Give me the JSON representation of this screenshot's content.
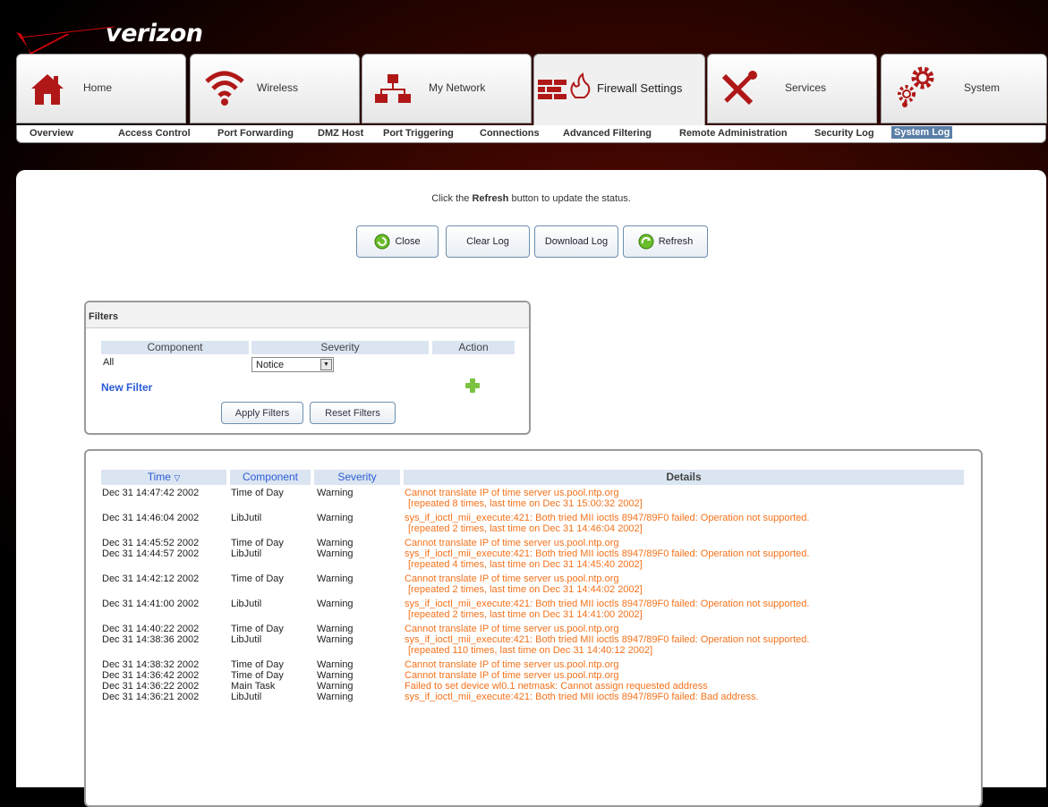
{
  "brand": {
    "logo_text": "verizon"
  },
  "tabs": [
    {
      "label": "Home",
      "icon": "home-icon"
    },
    {
      "label": "Wireless",
      "icon": "wifi-icon"
    },
    {
      "label": "My Network",
      "icon": "network-icon"
    },
    {
      "label": "Firewall Settings",
      "icon": "firewall-icon",
      "active": true
    },
    {
      "label": "Services",
      "icon": "tools-icon"
    },
    {
      "label": "System",
      "icon": "gears-icon"
    }
  ],
  "subnav": [
    {
      "label": "Overview"
    },
    {
      "label": "Access Control"
    },
    {
      "label": "Port Forwarding"
    },
    {
      "label": "DMZ Host"
    },
    {
      "label": "Port Triggering"
    },
    {
      "label": "Connections"
    },
    {
      "label": "Advanced Filtering"
    },
    {
      "label": "Remote Administration"
    },
    {
      "label": "Security Log"
    },
    {
      "label": "System Log",
      "active": true
    }
  ],
  "notice": {
    "before": "Click the ",
    "strong": "Refresh",
    "after": " button to update the status."
  },
  "buttons": {
    "close": "Close",
    "clear": "Clear Log",
    "download": "Download Log",
    "refresh": "Refresh"
  },
  "filters": {
    "title": "Filters",
    "headers": {
      "component": "Component",
      "severity": "Severity",
      "action": "Action"
    },
    "row": {
      "component": "All",
      "severity": "Notice"
    },
    "new_filter": "New Filter",
    "apply": "Apply Filters",
    "reset": "Reset Filters"
  },
  "log": {
    "headers": {
      "time": "Time",
      "component": "Component",
      "severity": "Severity",
      "details": "Details"
    },
    "rows": [
      {
        "time": "Dec 31 14:47:42 2002",
        "component": "Time of Day",
        "severity": "Warning",
        "details": [
          "Cannot translate IP of time server us.pool.ntp.org",
          "[repeated 8 times, last time on Dec 31 15:00:32 2002]"
        ]
      },
      {
        "time": "Dec 31 14:46:04 2002",
        "component": "LibJutil",
        "severity": "Warning",
        "details": [
          "sys_if_ioctl_mii_execute:421: Both tried MII ioctls 8947/89F0 failed: Operation not supported.",
          "[repeated 2 times, last time on Dec 31 14:46:04 2002]"
        ]
      },
      {
        "time": "Dec 31 14:45:52 2002",
        "component": "Time of Day",
        "severity": "Warning",
        "details": [
          "Cannot translate IP of time server us.pool.ntp.org"
        ]
      },
      {
        "time": "Dec 31 14:44:57 2002",
        "component": "LibJutil",
        "severity": "Warning",
        "details": [
          "sys_if_ioctl_mii_execute:421: Both tried MII ioctls 8947/89F0 failed: Operation not supported.",
          "[repeated 4 times, last time on Dec 31 14:45:40 2002]"
        ]
      },
      {
        "time": "Dec 31 14:42:12 2002",
        "component": "Time of Day",
        "severity": "Warning",
        "details": [
          "Cannot translate IP of time server us.pool.ntp.org",
          "[repeated 2 times, last time on Dec 31 14:44:02 2002]"
        ]
      },
      {
        "time": "Dec 31 14:41:00 2002",
        "component": "LibJutil",
        "severity": "Warning",
        "details": [
          "sys_if_ioctl_mii_execute:421: Both tried MII ioctls 8947/89F0 failed: Operation not supported.",
          "[repeated 2 times, last time on Dec 31 14:41:00 2002]"
        ]
      },
      {
        "time": "Dec 31 14:40:22 2002",
        "component": "Time of Day",
        "severity": "Warning",
        "details": [
          "Cannot translate IP of time server us.pool.ntp.org"
        ]
      },
      {
        "time": "Dec 31 14:38:36 2002",
        "component": "LibJutil",
        "severity": "Warning",
        "details": [
          "sys_if_ioctl_mii_execute:421: Both tried MII ioctls 8947/89F0 failed: Operation not supported.",
          "[repeated 110 times, last time on Dec 31 14:40:12 2002]"
        ]
      },
      {
        "time": "Dec 31 14:38:32 2002",
        "component": "Time of Day",
        "severity": "Warning",
        "details": [
          "Cannot translate IP of time server us.pool.ntp.org"
        ]
      },
      {
        "time": "Dec 31 14:36:42 2002",
        "component": "Time of Day",
        "severity": "Warning",
        "details": [
          "Cannot translate IP of time server us.pool.ntp.org"
        ]
      },
      {
        "time": "Dec 31 14:36:22 2002",
        "component": "Main Task",
        "severity": "Warning",
        "details": [
          "Failed to set device wl0.1 netmask: Cannot assign requested address"
        ]
      },
      {
        "time": "Dec 31 14:36:21 2002",
        "component": "LibJutil",
        "severity": "Warning",
        "details": [
          "sys_if_ioctl_mii_execute:421: Both tried MII ioctls 8947/89F0 failed: Bad address."
        ]
      }
    ]
  },
  "colors": {
    "accent": "#5b7fa6",
    "detail_text": "#f4721b",
    "header_bg": "#dbe5f1",
    "link": "#2a5bd7",
    "brand_red": "#cd040b"
  }
}
